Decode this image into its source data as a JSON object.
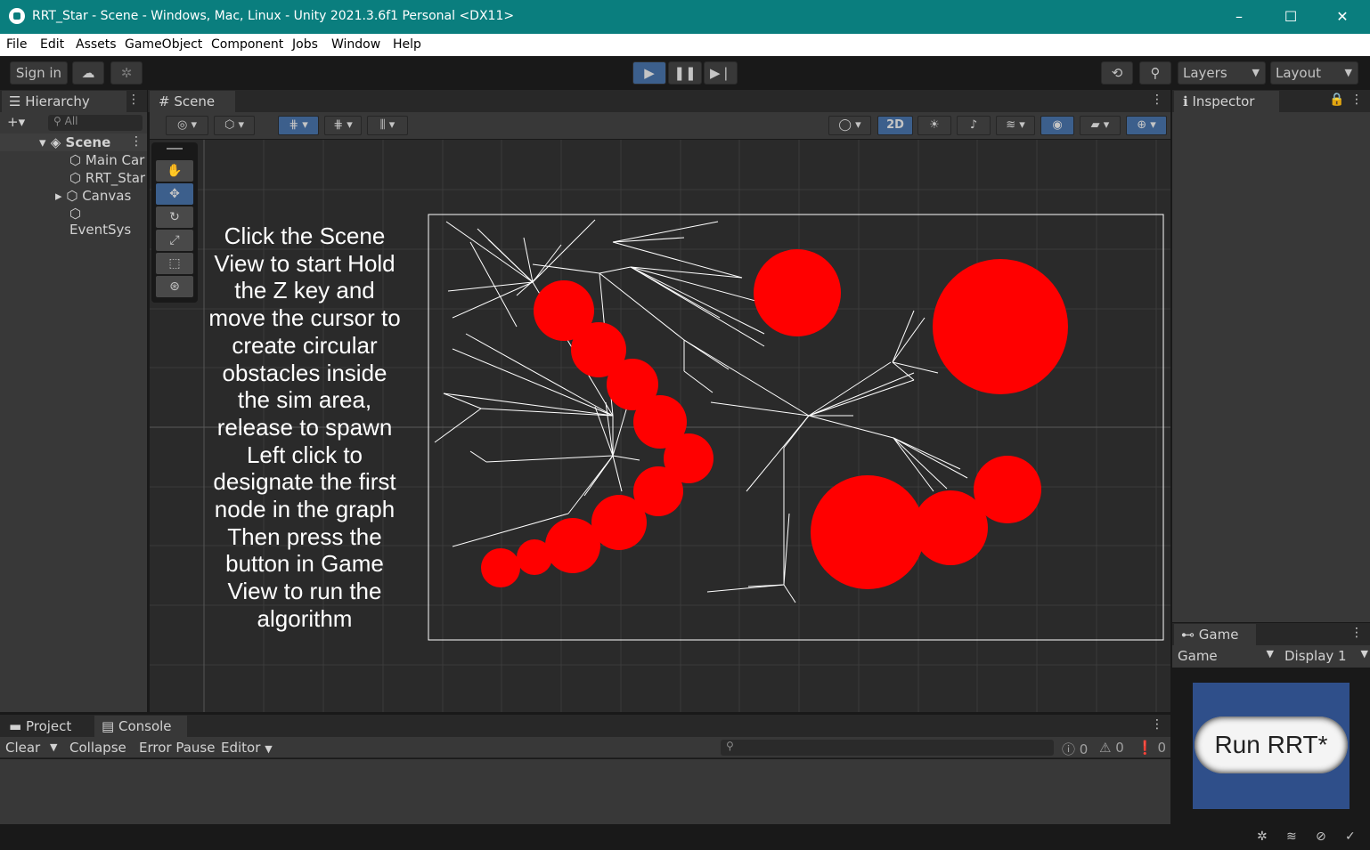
{
  "window": {
    "title": "RRT_Star - Scene - Windows, Mac, Linux - Unity 2021.3.6f1 Personal <DX11>",
    "controls": [
      "–",
      "☐",
      "✕"
    ]
  },
  "menu": [
    "File",
    "Edit",
    "Assets",
    "GameObject",
    "Component",
    "Jobs",
    "Window",
    "Help"
  ],
  "toolbar": {
    "sign_in": "Sign in",
    "layers": "Layers",
    "layout": "Layout"
  },
  "hierarchy": {
    "tab": "Hierarchy",
    "search_placeholder": "All",
    "scene": "Scene",
    "items": [
      "Main Car",
      "RRT_Star",
      "Canvas",
      "EventSys"
    ]
  },
  "scene": {
    "tab": "Scene",
    "mode_2d": "2D",
    "instructions": "Click the Scene View to start Hold the Z key and move the cursor to create circular obstacles inside the sim area, release to spawn Left click to designate the first node in the graph Then press the button in Game View to run the algorithm"
  },
  "inspector": {
    "tab": "Inspector"
  },
  "game": {
    "tab": "Game",
    "view_select": "Game",
    "display_select": "Display 1",
    "run_button": "Run RRT*"
  },
  "console": {
    "tab_project": "Project",
    "tab_console": "Console",
    "clear": "Clear",
    "collapse": "Collapse",
    "error_pause": "Error Pause",
    "editor": "Editor",
    "log_count": "0",
    "warning_count": "0",
    "error_count": "0"
  },
  "colors": {
    "titlebar": "#0a7e7e",
    "obstacle": "#ff0000",
    "game_bg": "#2f4f8a",
    "accent": "#3c5f8c"
  }
}
